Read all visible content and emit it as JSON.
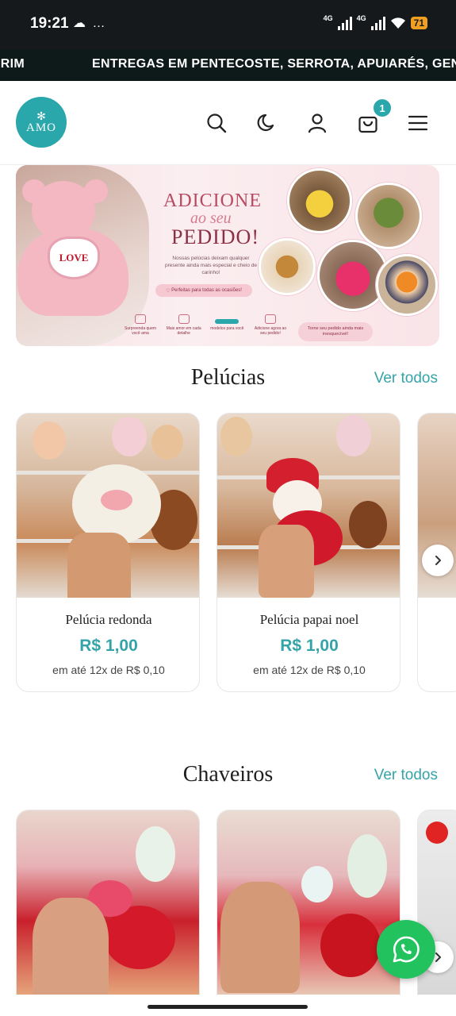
{
  "status_bar": {
    "time": "19:21",
    "left_icons": "☁ …",
    "net1": "4G",
    "net2": "4G",
    "battery": "71"
  },
  "marquee": {
    "prev_fragment": "IRIM",
    "text": "ENTREGAS EM PENTECOSTE, SERROTA, APUIARÉS, GENERA"
  },
  "header": {
    "logo_text": "AMO",
    "cart_count": "1",
    "icons": [
      "search-icon",
      "moon-icon",
      "user-icon",
      "cart-icon",
      "menu-icon"
    ]
  },
  "banner": {
    "title1": "ADICIONE",
    "title2": "ao seu",
    "title3": "PEDIDO!",
    "bear_heart": "LOVE",
    "description": "Nossas pelúcias deixam qualquer presente ainda mais especial e cheio de carinho!",
    "pill": "Perfeitas para todas as ocasiões!",
    "features": [
      "Surpreenda quem você ama",
      "Mais amor em cada detalhe",
      "",
      "Adicione agora ao seu pedido!"
    ],
    "feature_3_fragment": "modelos para você",
    "cta": "Torne seu pedido ainda mais inesquecível!"
  },
  "sections": [
    {
      "title": "Pelúcias",
      "see_all": "Ver todos",
      "products": [
        {
          "name": "Pelúcia redonda",
          "price": "R$ 1,00",
          "installments": "em até 12x de R$ 0,10"
        },
        {
          "name": "Pelúcia papai noel",
          "price": "R$ 1,00",
          "installments": "em até 12x de R$ 0,10"
        }
      ]
    },
    {
      "title": "Chaveiros",
      "see_all": "Ver todos"
    }
  ],
  "colors": {
    "accent": "#35a4a8",
    "logo_bg": "#2aa7ab",
    "whatsapp": "#22c35e",
    "marquee_bg": "#0e1a19"
  }
}
